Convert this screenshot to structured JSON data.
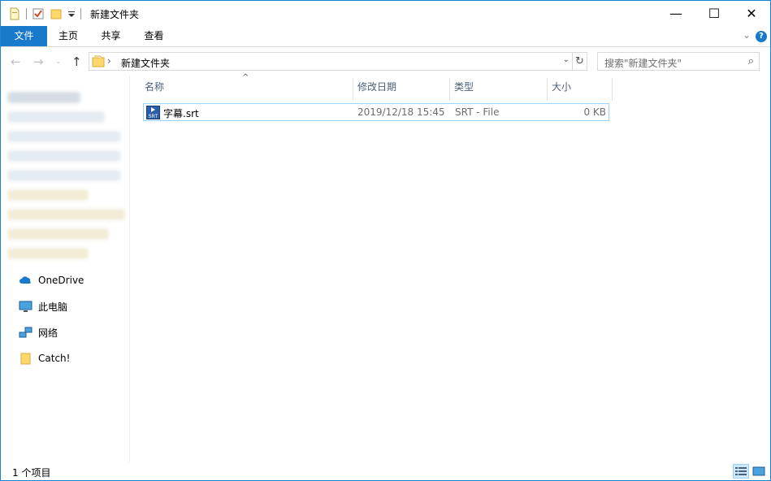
{
  "window": {
    "title": "新建文件夹",
    "controls": {
      "minimize": "—",
      "maximize": "☐",
      "close": "✕"
    }
  },
  "ribbon": {
    "tabs": [
      "文件",
      "主页",
      "共享",
      "查看"
    ],
    "help": "?"
  },
  "address": {
    "path": "新建文件夹",
    "search_placeholder": "搜索\"新建文件夹\""
  },
  "nav": {
    "items": [
      {
        "label": "OneDrive",
        "icon": "onedrive-cloud-icon"
      },
      {
        "label": "此电脑",
        "icon": "computer-icon"
      },
      {
        "label": "网络",
        "icon": "network-icon"
      },
      {
        "label": "Catch!",
        "icon": "folder-icon"
      }
    ]
  },
  "table": {
    "columns": [
      "名称",
      "修改日期",
      "类型",
      "大小"
    ],
    "rows": [
      {
        "name": "字幕.srt",
        "date": "2019/12/18 15:45",
        "type": "SRT - File",
        "size": "0 KB",
        "icon": "srt-file-icon"
      }
    ]
  },
  "status": {
    "count": "1 个项目"
  },
  "colors": {
    "accent": "#1979ca",
    "selection_border": "#99d1ff",
    "header_text": "#4c607a"
  }
}
